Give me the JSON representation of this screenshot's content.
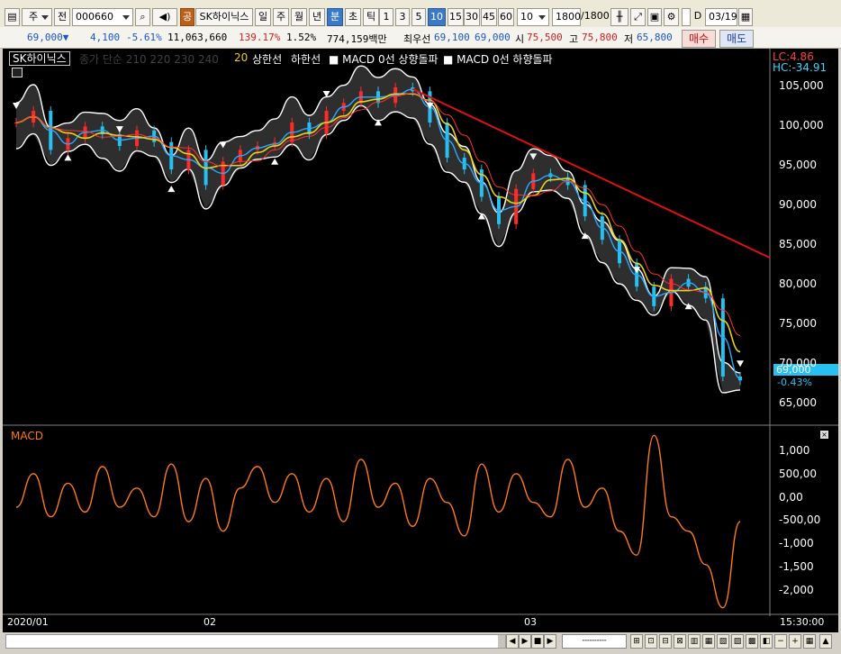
{
  "toolbar": {
    "period_main": "주",
    "prev_label": "전",
    "stock_code": "000660",
    "code_badge": "공",
    "stock_name": "SK하이닉스",
    "period_tabs": [
      "일",
      "주",
      "월",
      "년"
    ],
    "minute_tab": "분",
    "second_tab": "초",
    "tick_tab": "틱",
    "intervals": [
      "1",
      "3",
      "5",
      "10",
      "15",
      "30",
      "45",
      "60"
    ],
    "selected_interval": "10",
    "interval_select": "10",
    "bars": "1800",
    "bars_total": "/1800",
    "d_label": "D",
    "date": "03/19"
  },
  "quote": {
    "price": "69,000▼",
    "change": "4,100",
    "change_pct": "-5.61%",
    "volume": "11,063,660",
    "volume_ratio": "139.17%",
    "turnover": "1.52%",
    "amount": "774,159백만",
    "best_label": "최우선",
    "best_ask": "69,100",
    "best_bid": "69,000",
    "open_label": "시",
    "open": "75,500",
    "high_label": "고",
    "high": "75,800",
    "low_label": "저",
    "low": "65,800",
    "buy_label": "매수",
    "sell_label": "매도"
  },
  "legend": {
    "stock": "SK하이닉스",
    "ma_list": "종가 단순 210  220  230  240",
    "ma20": "20",
    "upper": "상한선",
    "lower": "하한선",
    "macd_up": "■ MACD 0선 상향돌파",
    "macd_down": "■ MACD 0선 하향돌파",
    "lc": "LC:4.86",
    "hc": "HC:-34.91",
    "current_price": "69,000",
    "current_change": "-0.43%",
    "macd": "MACD"
  },
  "axes": {
    "price_ticks": [
      "105,000",
      "100,000",
      "95,000",
      "90,000",
      "85,000",
      "80,000",
      "75,000",
      "70,000",
      "65,000"
    ],
    "macd_ticks": [
      "1,000",
      "500,00",
      "0,00",
      "-500,00",
      "-1,000",
      "-1,500",
      "-2,000"
    ],
    "x_ticks": [
      "2020/01",
      "02",
      "03"
    ],
    "clock": "15:30:00"
  },
  "colors": {
    "background": "#000000",
    "candle_up": "#ff2a2a",
    "candle_down": "#27c0f0",
    "ma20": "#e8d21c",
    "macd": "#ff7a1a",
    "trendline": "#e01010",
    "envelope": "#ffffff"
  },
  "chart_data": [
    {
      "type": "line",
      "title": "SK하이닉스",
      "series": [
        {
          "name": "종가",
          "values": [
            101500,
            103000,
            98000,
            99500,
            101000,
            100000,
            98500,
            100500,
            99000,
            95500,
            98000,
            93500,
            96500,
            98000,
            98500,
            99000,
            101500,
            100000,
            103000,
            104000,
            105500,
            104000,
            106000,
            105500,
            101500,
            97000,
            95500,
            92000,
            88500,
            93000,
            95000,
            94500,
            93500,
            89500,
            86500,
            83500,
            80500,
            78000,
            81500,
            80500,
            79000,
            69000,
            68500
          ]
        }
      ],
      "ylim": [
        63000,
        107500
      ],
      "xlabel": "",
      "ylabel": ""
    },
    {
      "type": "line",
      "title": "MACD",
      "series": [
        {
          "name": "MACD",
          "values": [
            -300,
            400,
            -500,
            200,
            -400,
            550,
            -300,
            100,
            -500,
            600,
            -600,
            300,
            -800,
            100,
            550,
            -200,
            400,
            -400,
            300,
            -600,
            700,
            -300,
            200,
            -700,
            300,
            -200,
            -900,
            600,
            -400,
            400,
            -200,
            -500,
            700,
            -300,
            100,
            -800,
            -1300,
            1200,
            -500,
            -800,
            -1500,
            -2400,
            -600
          ]
        }
      ],
      "ylim": [
        -2500,
        1300
      ],
      "xlabel": "",
      "ylabel": ""
    }
  ]
}
